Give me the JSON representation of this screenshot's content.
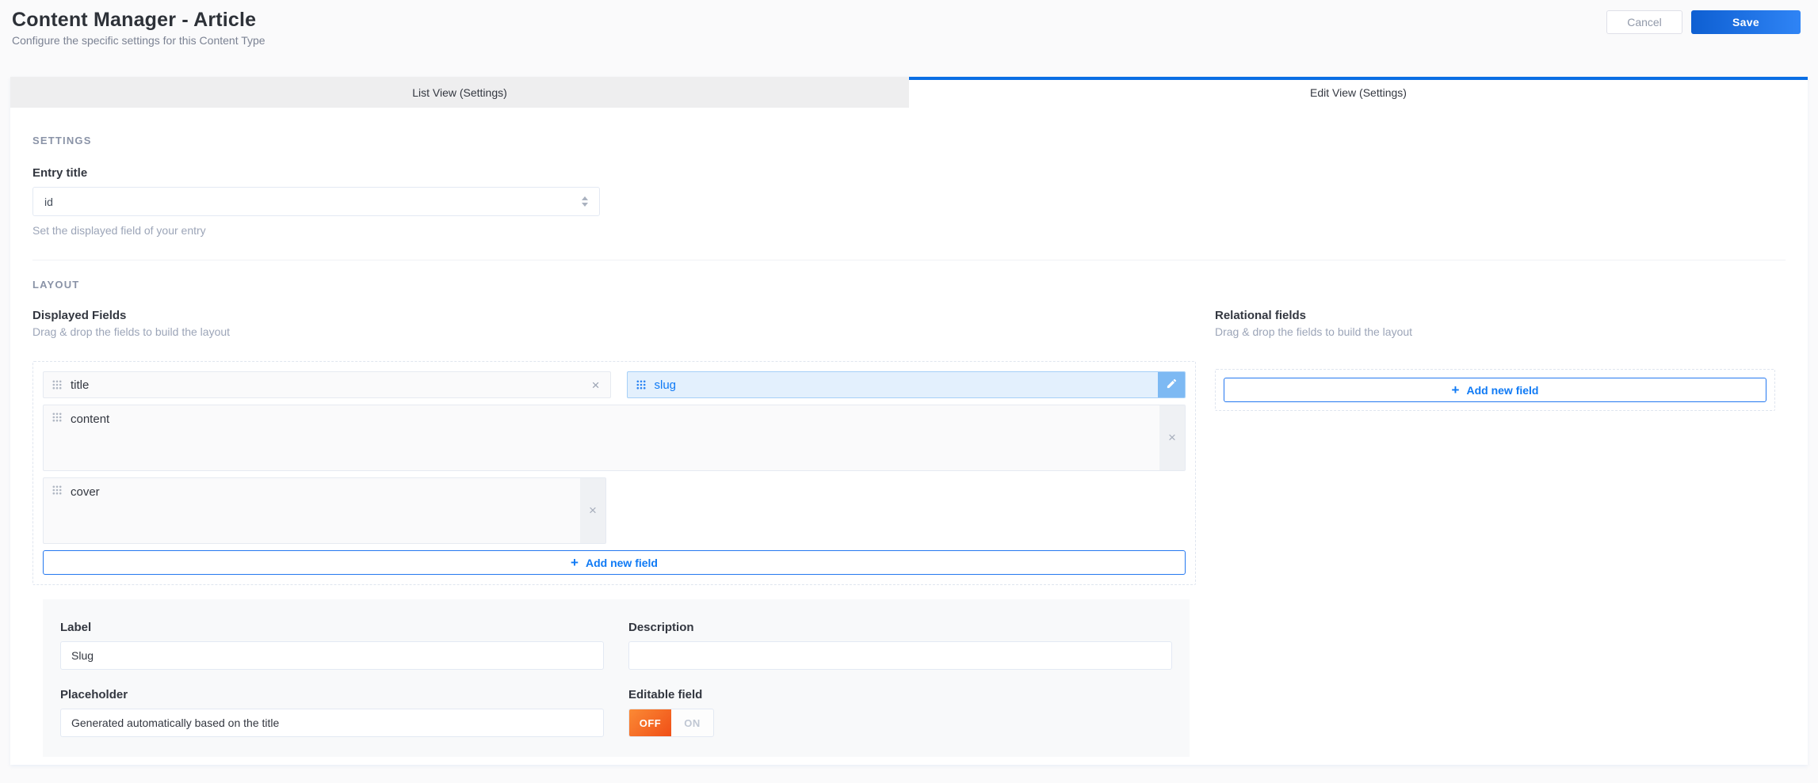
{
  "header": {
    "title": "Content Manager - Article",
    "subtitle": "Configure the specific settings for this Content Type",
    "cancel_label": "Cancel",
    "save_label": "Save"
  },
  "tabs": [
    {
      "label": "List View (Settings)",
      "active": false
    },
    {
      "label": "Edit View (Settings)",
      "active": true
    }
  ],
  "settings_section": {
    "title": "SETTINGS",
    "entry_title": {
      "label": "Entry title",
      "value": "id",
      "helper": "Set the displayed field of your entry"
    }
  },
  "layout_section": {
    "title": "LAYOUT",
    "displayed_fields": {
      "title": "Displayed Fields",
      "subtitle": "Drag & drop the fields to build the layout",
      "fields": [
        {
          "name": "title"
        },
        {
          "name": "slug",
          "selected": true
        },
        {
          "name": "content"
        },
        {
          "name": "cover"
        }
      ],
      "add_button_label": "Add new field"
    },
    "relational_fields": {
      "title": "Relational fields",
      "subtitle": "Drag & drop the fields to build the layout",
      "add_button_label": "Add new field"
    }
  },
  "field_editor": {
    "label": {
      "label": "Label",
      "value": "Slug"
    },
    "description": {
      "label": "Description",
      "value": ""
    },
    "placeholder": {
      "label": "Placeholder",
      "value": "Generated automatically based on the title"
    },
    "editable": {
      "label": "Editable field",
      "off_label": "OFF",
      "on_label": "ON",
      "state": "OFF"
    }
  },
  "colors": {
    "accent_blue": "#0f7af5",
    "tab_active_border": "#0a6ee4",
    "selected_field_bg": "#e3f0fd",
    "selected_field_border": "#a6d0f8",
    "edit_button_bg": "#7db9f3",
    "toggle_off_gradient": [
      "#fb8a35",
      "#f04f17"
    ],
    "save_gradient": [
      "#0e5fd2",
      "#2f84f5"
    ]
  }
}
